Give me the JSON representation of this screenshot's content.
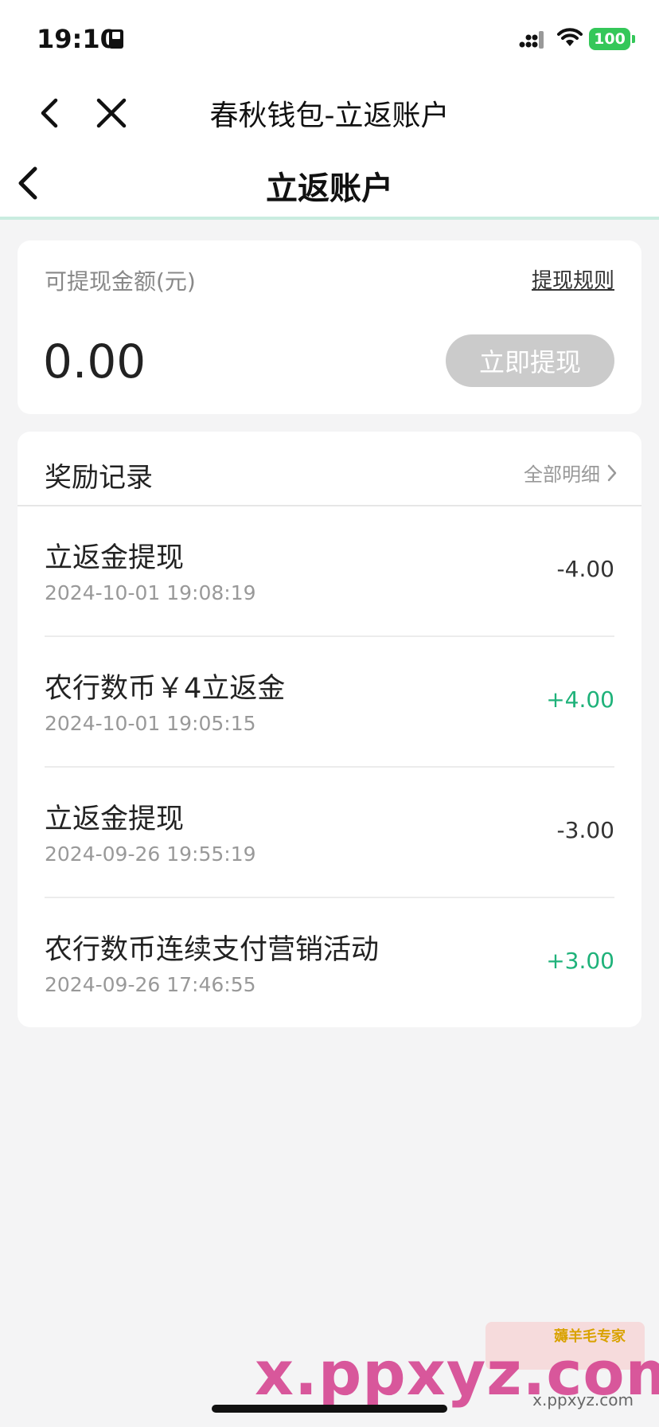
{
  "status_bar": {
    "time": "19:10",
    "battery": "100"
  },
  "mini_nav": {
    "title": "春秋钱包-立返账户"
  },
  "header": {
    "title": "立返账户"
  },
  "balance": {
    "label": "可提现金额(元)",
    "rules_link": "提现规则",
    "amount": "0.00",
    "withdraw_button": "立即提现"
  },
  "records": {
    "title": "奖励记录",
    "all_details": "全部明细",
    "items": [
      {
        "title": "立返金提现",
        "time": "2024-10-01 19:08:19",
        "amount": "-4.00",
        "type": "negative"
      },
      {
        "title": "农行数币￥4立返金",
        "time": "2024-10-01 19:05:15",
        "amount": "+4.00",
        "type": "positive"
      },
      {
        "title": "立返金提现",
        "time": "2024-09-26 19:55:19",
        "amount": "-3.00",
        "type": "negative"
      },
      {
        "title": "农行数币连续支付营销活动",
        "time": "2024-09-26 17:46:55",
        "amount": "+3.00",
        "type": "positive"
      }
    ]
  },
  "watermark": {
    "main": "x.ppxyz.com",
    "sub": "x.ppxyz.com",
    "badge": "薅羊毛专家"
  },
  "colors": {
    "accent_green": "#1fb27a",
    "header_divider": "#c9ece0",
    "disabled_button": "#cbcbcb",
    "battery": "#34c759"
  },
  "icons": {
    "status": [
      "book-icon",
      "signal-icon",
      "wifi-icon"
    ],
    "nav": [
      "chevron-left-icon",
      "close-icon",
      "chevron-right-icon"
    ]
  }
}
